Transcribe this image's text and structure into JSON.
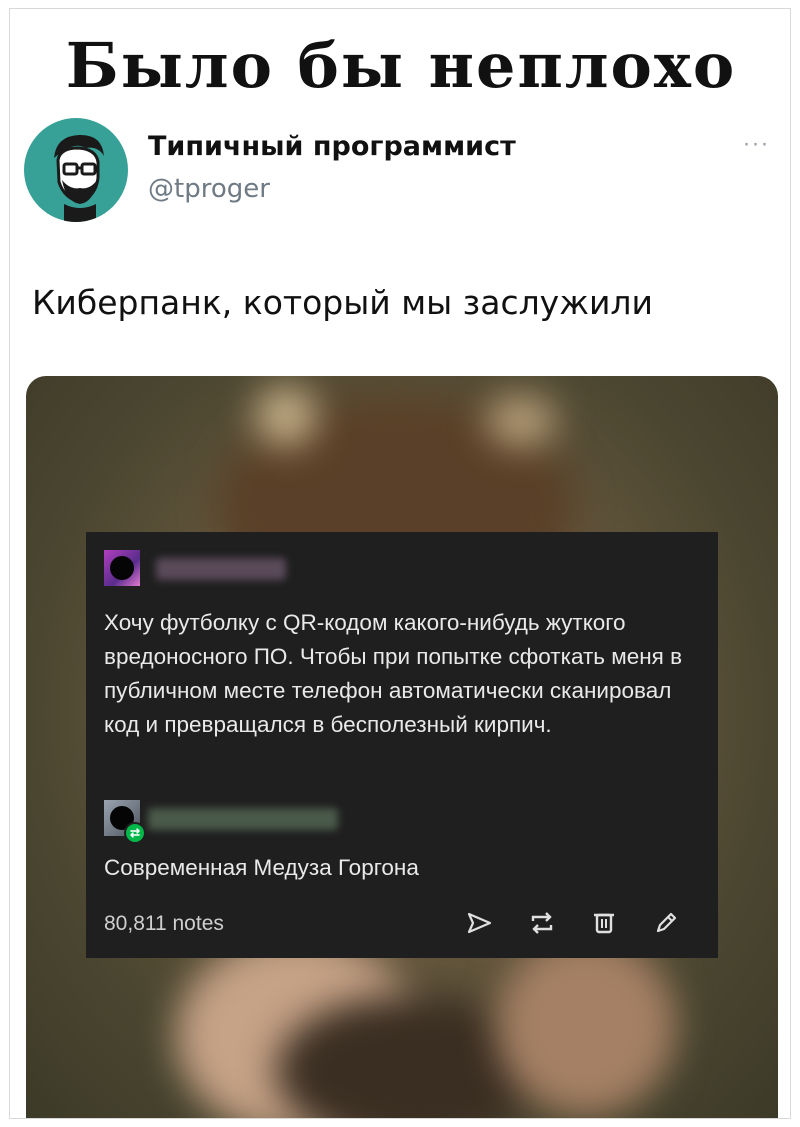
{
  "meme": {
    "headline": "Было бы неплохо"
  },
  "tweet": {
    "author_name": "Типичный программист",
    "author_handle": "@tproger",
    "more_label": "···",
    "text": "Киберпанк, который мы заслужили"
  },
  "tumblr_post": {
    "post_text": "Хочу футболку с QR-кодом какого-нибудь жуткого вредоносного ПО. Чтобы при попытке сфоткать меня в публичном месте телефон автоматически сканировал код и превращался в бесполезный кирпич.",
    "reply_text": "Современная Медуза Горгона",
    "notes_count": "80,811 notes",
    "actions": [
      "send-icon",
      "reblog-icon",
      "delete-icon",
      "edit-icon"
    ]
  },
  "colors": {
    "avatar_bg": "#37a197",
    "card_bg": "#1f1f1f",
    "reblog_badge": "#00b84a",
    "handle_gray": "#6f7a84"
  }
}
